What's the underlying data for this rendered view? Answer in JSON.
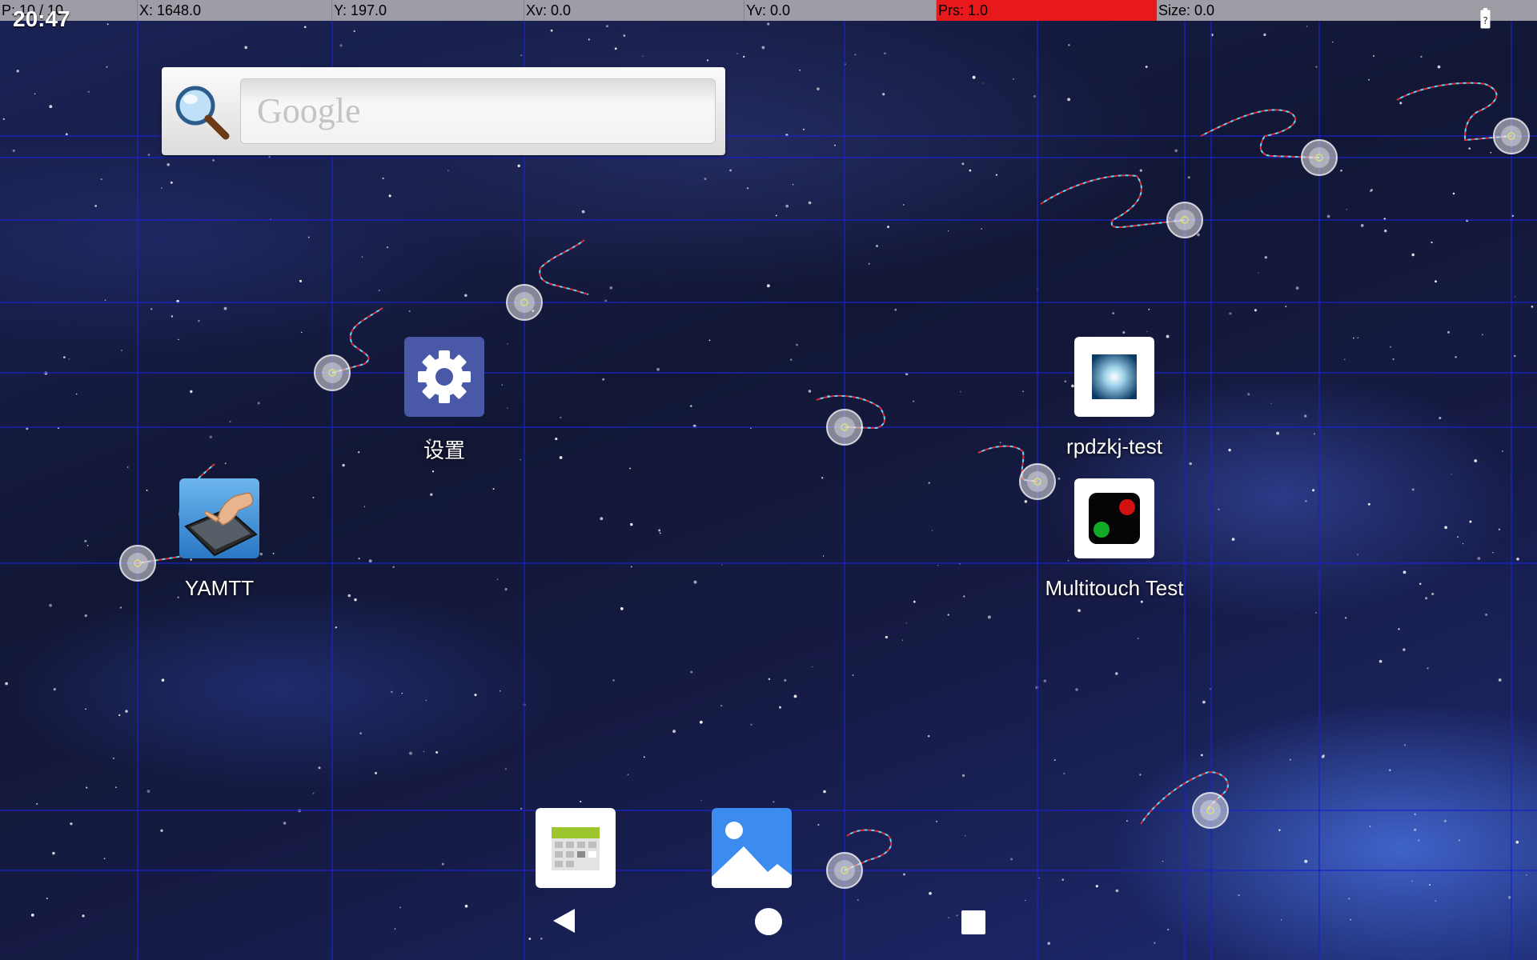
{
  "pointer_info": {
    "pointers": "P: 10 / 10",
    "x": "X: 1648.0",
    "y": "Y: 197.0",
    "xv": "Xv: 0.0",
    "yv": "Yv: 0.0",
    "pressure": "Prs: 1.0",
    "size": "Size: 0.0"
  },
  "status": {
    "time": "20:47"
  },
  "search_widget": {
    "placeholder": "Google"
  },
  "apps": {
    "settings": "设置",
    "yamtt": "YAMTT",
    "rpdzkj_test": "rpdzkj-test",
    "multitouch_test": "Multitouch Test"
  },
  "colors": {
    "pressure_bar": "#e8191c",
    "grid_line": "#1a23c8",
    "trail_red": "#e0303a",
    "trail_cyan": "#5fd8ff",
    "settings_tile": "#4a58a8",
    "gallery_tile": "#3c8cf0"
  },
  "icons": {
    "search": "magnifier-icon",
    "settings": "gear-icon",
    "battery": "battery-unknown-icon",
    "back": "triangle-back-icon",
    "home": "circle-home-icon",
    "recents": "square-recents-icon"
  }
}
